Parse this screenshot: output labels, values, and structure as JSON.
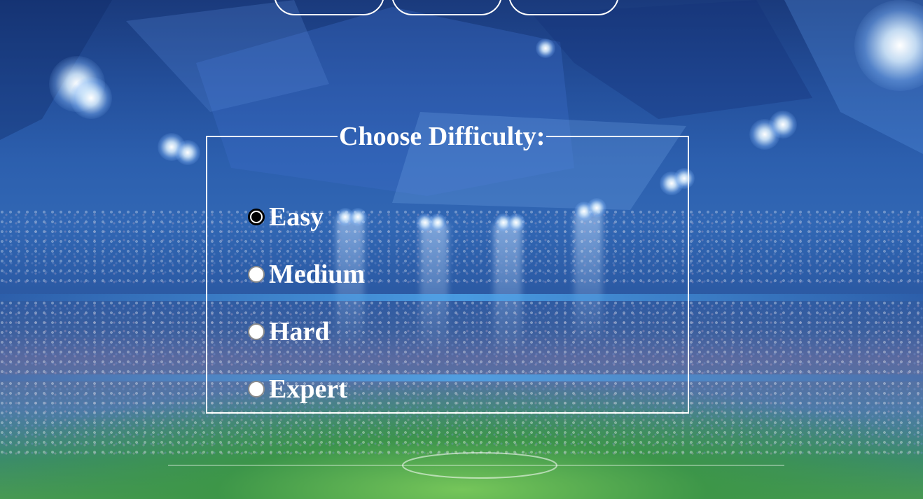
{
  "top_nav": {
    "buttons": [
      "",
      "",
      ""
    ]
  },
  "difficulty": {
    "title": "Choose Difficulty:",
    "options": [
      {
        "label": "Easy",
        "checked": true
      },
      {
        "label": "Medium",
        "checked": false
      },
      {
        "label": "Hard",
        "checked": false
      },
      {
        "label": "Expert",
        "checked": false
      }
    ]
  },
  "colors": {
    "text": "#ffffff",
    "border": "#ffffff",
    "radio_checked": "#000000",
    "radio_unchecked": "#ffffff"
  }
}
